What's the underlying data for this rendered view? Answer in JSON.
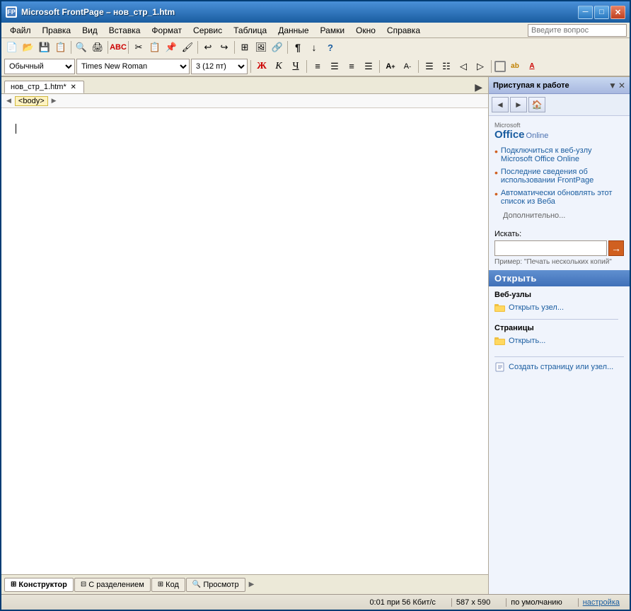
{
  "window": {
    "title": "Microsoft FrontPage – нов_стр_1.htm",
    "icon": "frontpage-icon"
  },
  "titlebar": {
    "minimize_label": "─",
    "maximize_label": "□",
    "close_label": "✕"
  },
  "menubar": {
    "items": [
      {
        "label": "Файл"
      },
      {
        "label": "Правка"
      },
      {
        "label": "Вид"
      },
      {
        "label": "Вставка"
      },
      {
        "label": "Формат"
      },
      {
        "label": "Сервис"
      },
      {
        "label": "Таблица"
      },
      {
        "label": "Данные"
      },
      {
        "label": "Рамки"
      },
      {
        "label": "Окно"
      },
      {
        "label": "Справка"
      }
    ],
    "search_placeholder": "Введите вопрос"
  },
  "format_toolbar": {
    "style_value": "Обычный",
    "font_value": "Times New Roman",
    "size_value": "3 (12 пт)",
    "bold_label": "Ж",
    "italic_label": "К",
    "underline_label": "Ч"
  },
  "editor": {
    "tab_label": "нов_стр_1.htm*",
    "breadcrumb": "<body>"
  },
  "bottom_tabs": [
    {
      "label": "Конструктор",
      "active": true
    },
    {
      "label": "С разделением",
      "active": false
    },
    {
      "label": "Код",
      "active": false
    },
    {
      "label": "Просмотр",
      "active": false
    }
  ],
  "status_bar": {
    "time": "0:01 при 56 Кбит/с",
    "dimensions": "587 х 590",
    "zoom": "по умолчанию",
    "settings": "настройка"
  },
  "right_panel": {
    "title": "Приступая к работе",
    "nav_buttons": [
      "◄",
      "►",
      "🏠"
    ],
    "office_online": {
      "ms_label": "Microsoft",
      "title": "Office Online",
      "links": [
        "Подключиться к веб-узлу Microsoft Office Online",
        "Последние сведения об использовании FrontPage",
        "Автоматически обновлять этот список из Веба"
      ],
      "more_label": "Дополнительно..."
    },
    "search": {
      "label": "Искать:",
      "placeholder": "",
      "button": "→",
      "example": "Пример: \"Печать нескольких копий\""
    },
    "open_section": {
      "header": "Открыть",
      "webnodes_label": "Веб-узлы",
      "open_webnode_label": "Открыть узел...",
      "pages_label": "Страницы",
      "open_page_label": "Открыть...",
      "create_label": "Создать страницу или узел..."
    }
  }
}
